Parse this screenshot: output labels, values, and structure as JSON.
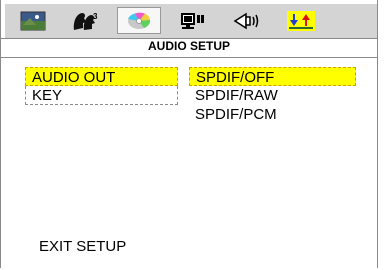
{
  "header": {
    "title": "AUDIO SETUP"
  },
  "toolbar": {
    "icons": [
      {
        "name": "general-setup-icon"
      },
      {
        "name": "language-setup-icon"
      },
      {
        "name": "audio-setup-icon",
        "active": true
      },
      {
        "name": "video-setup-icon"
      },
      {
        "name": "speaker-setup-icon"
      },
      {
        "name": "preferences-icon"
      }
    ]
  },
  "left_menu": {
    "items": [
      {
        "label": "AUDIO OUT",
        "selected": true
      },
      {
        "label": "KEY"
      }
    ]
  },
  "right_menu": {
    "items": [
      {
        "label": "SPDIF/OFF",
        "selected": true
      },
      {
        "label": "SPDIF/RAW"
      },
      {
        "label": "SPDIF/PCM"
      }
    ]
  },
  "footer": {
    "exit_label": "EXIT SETUP"
  },
  "colors": {
    "highlight": "#ffff00",
    "toolbar": "#d4d4d4"
  }
}
